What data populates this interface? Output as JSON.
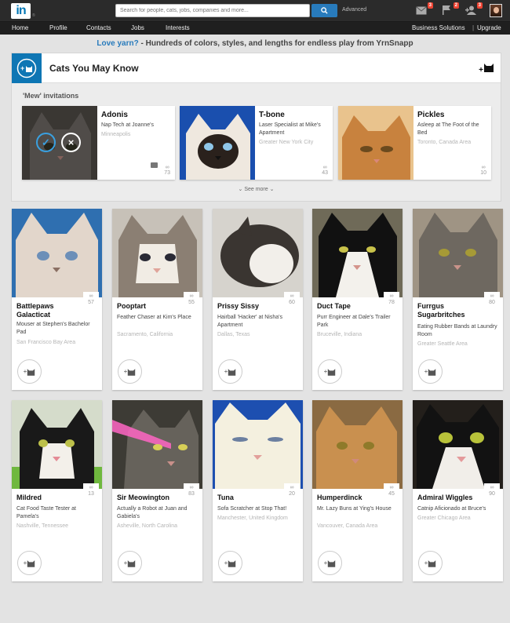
{
  "header": {
    "logo": "in",
    "search_placeholder": "Search for people, cats, jobs, companies and more...",
    "advanced": "Advanced",
    "badges": {
      "messages": "3",
      "notifications": "2",
      "invites": "3"
    }
  },
  "nav": {
    "items": [
      "Home",
      "Profile",
      "Contacts",
      "Jobs",
      "Interests"
    ],
    "right": [
      "Business Solutions",
      "Upgrade"
    ]
  },
  "promo": {
    "link": "Love yarn?",
    "text": " - Hundreds of colors, styles, and lengths for endless play from YrnSnapp"
  },
  "pymk": {
    "title": "Cats You May Know",
    "add_label": "+",
    "invitations_label": "'Mew' invitations",
    "see_more": "See more",
    "invitations": [
      {
        "name": "Adonis",
        "desc": "Nap Tech at Joanne's",
        "loc": "Minneapolis",
        "count": "73"
      },
      {
        "name": "T-bone",
        "desc": "Laser Specialist at Mike's Apartment",
        "loc": "Greater New York City",
        "count": "43"
      },
      {
        "name": "Pickles",
        "desc": "Asleep at The Foot of the Bed",
        "loc": "Toronto, Canada Area",
        "count": "10"
      }
    ]
  },
  "cards": [
    {
      "name": "Battlepaws Galacticat",
      "desc": "Mouser at Stephen's Bachelor Pad",
      "loc": "San Francisco Bay Area",
      "count": "57"
    },
    {
      "name": "Pooptart",
      "desc": "Feather Chaser at Kim's Place",
      "loc": "Sacramento, California",
      "count": "55"
    },
    {
      "name": "Prissy Sissy",
      "desc": "Hairball 'Hacker' at Nisha's Apartment",
      "loc": "Dallas, Texas",
      "count": "60"
    },
    {
      "name": "Duct Tape",
      "desc": "Purr Engineer at Dale's Trailer Park",
      "loc": "Bruceville, Indiana",
      "count": "78"
    },
    {
      "name": "Furrgus Sugarbritches",
      "desc": "Eating Rubber Bands at Laundry Room",
      "loc": "Greater Seattle Area",
      "count": "80"
    },
    {
      "name": "Mildred",
      "desc": "Cat Food Taste Tester at Pamela's",
      "loc": "Nashville, Tennessee",
      "count": "13"
    },
    {
      "name": "Sir Meowington",
      "desc": "Actually a Robot at Juan and Gabiela's",
      "loc": "Asheville, North Carolina",
      "count": "83"
    },
    {
      "name": "Tuna",
      "desc": "Sofa Scratcher at Stop That!",
      "loc": "Manchester, United Kingdom",
      "count": "20"
    },
    {
      "name": "Humperdinck",
      "desc": "Mr. Lazy Buns at Ying's House",
      "loc": "Vancouver, Canada Area",
      "count": "45"
    },
    {
      "name": "Admiral Wiggles",
      "desc": "Catnip Aficionado at Bruce's",
      "loc": "Greater Chicago Area",
      "count": "90"
    }
  ],
  "colors": {
    "brand": "#0e76b4",
    "topbar": "#2b2b2b",
    "badge": "#ee4433"
  }
}
